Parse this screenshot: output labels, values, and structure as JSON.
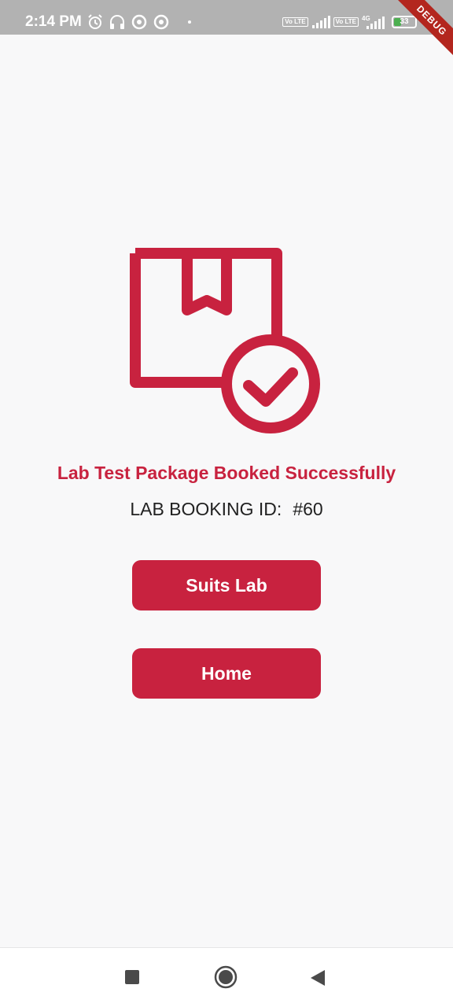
{
  "status_bar": {
    "time": "2:14 PM",
    "left_icons": [
      "alarm-icon",
      "headset-icon",
      "data-saver-icon",
      "data-saver-icon",
      "dot-icon"
    ],
    "volte_label": "Vo LTE",
    "network_label": "4G",
    "battery_level": "33"
  },
  "debug_banner": "DEBUG",
  "main": {
    "icon": "package-check-icon",
    "title": "Lab Test Package Booked Successfully",
    "booking_label": "LAB BOOKING ID:",
    "booking_id": "#60",
    "primary_button": "Suits Lab",
    "secondary_button": "Home"
  },
  "nav_bar": {
    "icons": [
      "recents-square-icon",
      "home-circle-icon",
      "back-triangle-icon"
    ]
  },
  "colors": {
    "accent": "#c8223f",
    "background": "#f8f8f9",
    "status_bar": "#b2b2b2"
  }
}
